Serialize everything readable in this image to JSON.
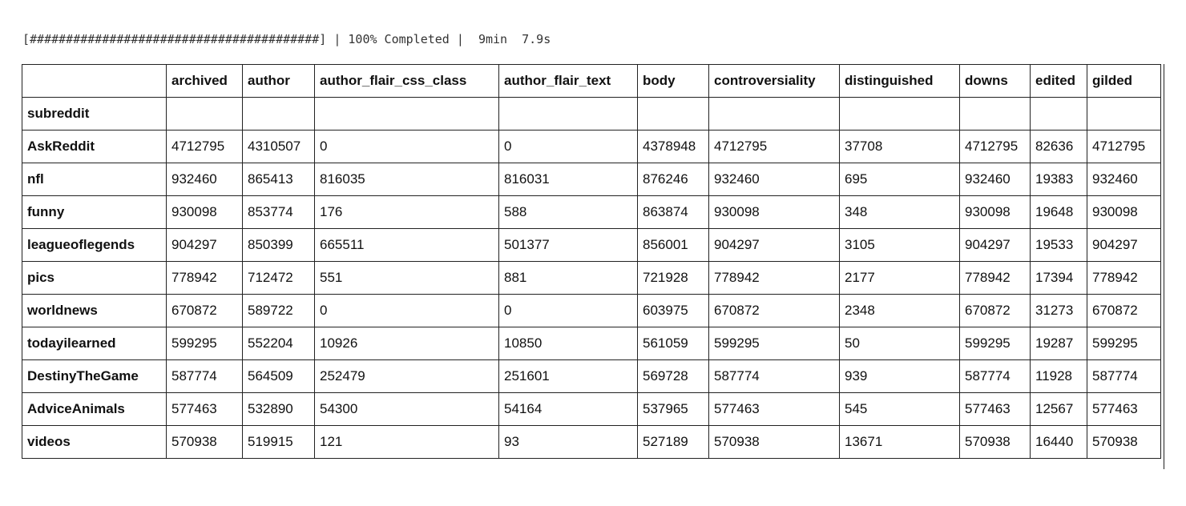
{
  "progress": {
    "text": "[########################################] | 100% Completed |  9min  7.9s"
  },
  "table": {
    "columns": [
      "archived",
      "author",
      "author_flair_css_class",
      "author_flair_text",
      "body",
      "controversiality",
      "distinguished",
      "downs",
      "edited",
      "gilded"
    ],
    "index_name": "subreddit",
    "rows": [
      {
        "index": "AskReddit",
        "values": [
          "4712795",
          "4310507",
          "0",
          "0",
          "4378948",
          "4712795",
          "37708",
          "4712795",
          "82636",
          "4712795"
        ]
      },
      {
        "index": "nfl",
        "values": [
          "932460",
          "865413",
          "816035",
          "816031",
          "876246",
          "932460",
          "695",
          "932460",
          "19383",
          "932460"
        ]
      },
      {
        "index": "funny",
        "values": [
          "930098",
          "853774",
          "176",
          "588",
          "863874",
          "930098",
          "348",
          "930098",
          "19648",
          "930098"
        ]
      },
      {
        "index": "leagueoflegends",
        "values": [
          "904297",
          "850399",
          "665511",
          "501377",
          "856001",
          "904297",
          "3105",
          "904297",
          "19533",
          "904297"
        ]
      },
      {
        "index": "pics",
        "values": [
          "778942",
          "712472",
          "551",
          "881",
          "721928",
          "778942",
          "2177",
          "778942",
          "17394",
          "778942"
        ]
      },
      {
        "index": "worldnews",
        "values": [
          "670872",
          "589722",
          "0",
          "0",
          "603975",
          "670872",
          "2348",
          "670872",
          "31273",
          "670872"
        ]
      },
      {
        "index": "todayilearned",
        "values": [
          "599295",
          "552204",
          "10926",
          "10850",
          "561059",
          "599295",
          "50",
          "599295",
          "19287",
          "599295"
        ]
      },
      {
        "index": "DestinyTheGame",
        "values": [
          "587774",
          "564509",
          "252479",
          "251601",
          "569728",
          "587774",
          "939",
          "587774",
          "11928",
          "587774"
        ]
      },
      {
        "index": "AdviceAnimals",
        "values": [
          "577463",
          "532890",
          "54300",
          "54164",
          "537965",
          "577463",
          "545",
          "577463",
          "12567",
          "577463"
        ]
      },
      {
        "index": "videos",
        "values": [
          "570938",
          "519915",
          "121",
          "93",
          "527189",
          "570938",
          "13671",
          "570938",
          "16440",
          "570938"
        ]
      }
    ]
  }
}
